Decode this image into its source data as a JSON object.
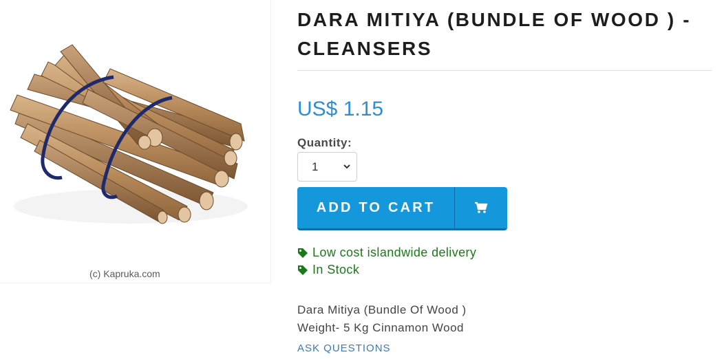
{
  "product": {
    "title": "DARA MITIYA (BUNDLE OF WOOD ) - CLEANSERS",
    "price": "US$ 1.15",
    "quantity_label": "Quantity:",
    "quantity_value": "1",
    "image_watermark": "(c) Kapruka.com",
    "image_alt": "bundle-of-wood-image"
  },
  "cart": {
    "add_label": "ADD TO CART",
    "icon": "shopping-cart-icon"
  },
  "badges": [
    {
      "icon": "tag-icon",
      "text": "Low cost islandwide delivery"
    },
    {
      "icon": "tag-icon",
      "text": "In Stock"
    }
  ],
  "description": {
    "line1": "Dara Mitiya (Bundle Of Wood )",
    "line2": "Weight- 5 Kg Cinnamon Wood"
  },
  "links": {
    "ask_questions": "ASK QUESTIONS"
  },
  "colors": {
    "price": "#2c8fd6",
    "button": "#1597dc",
    "badge_text": "#1a7a1a",
    "link": "#3a7ab5"
  }
}
